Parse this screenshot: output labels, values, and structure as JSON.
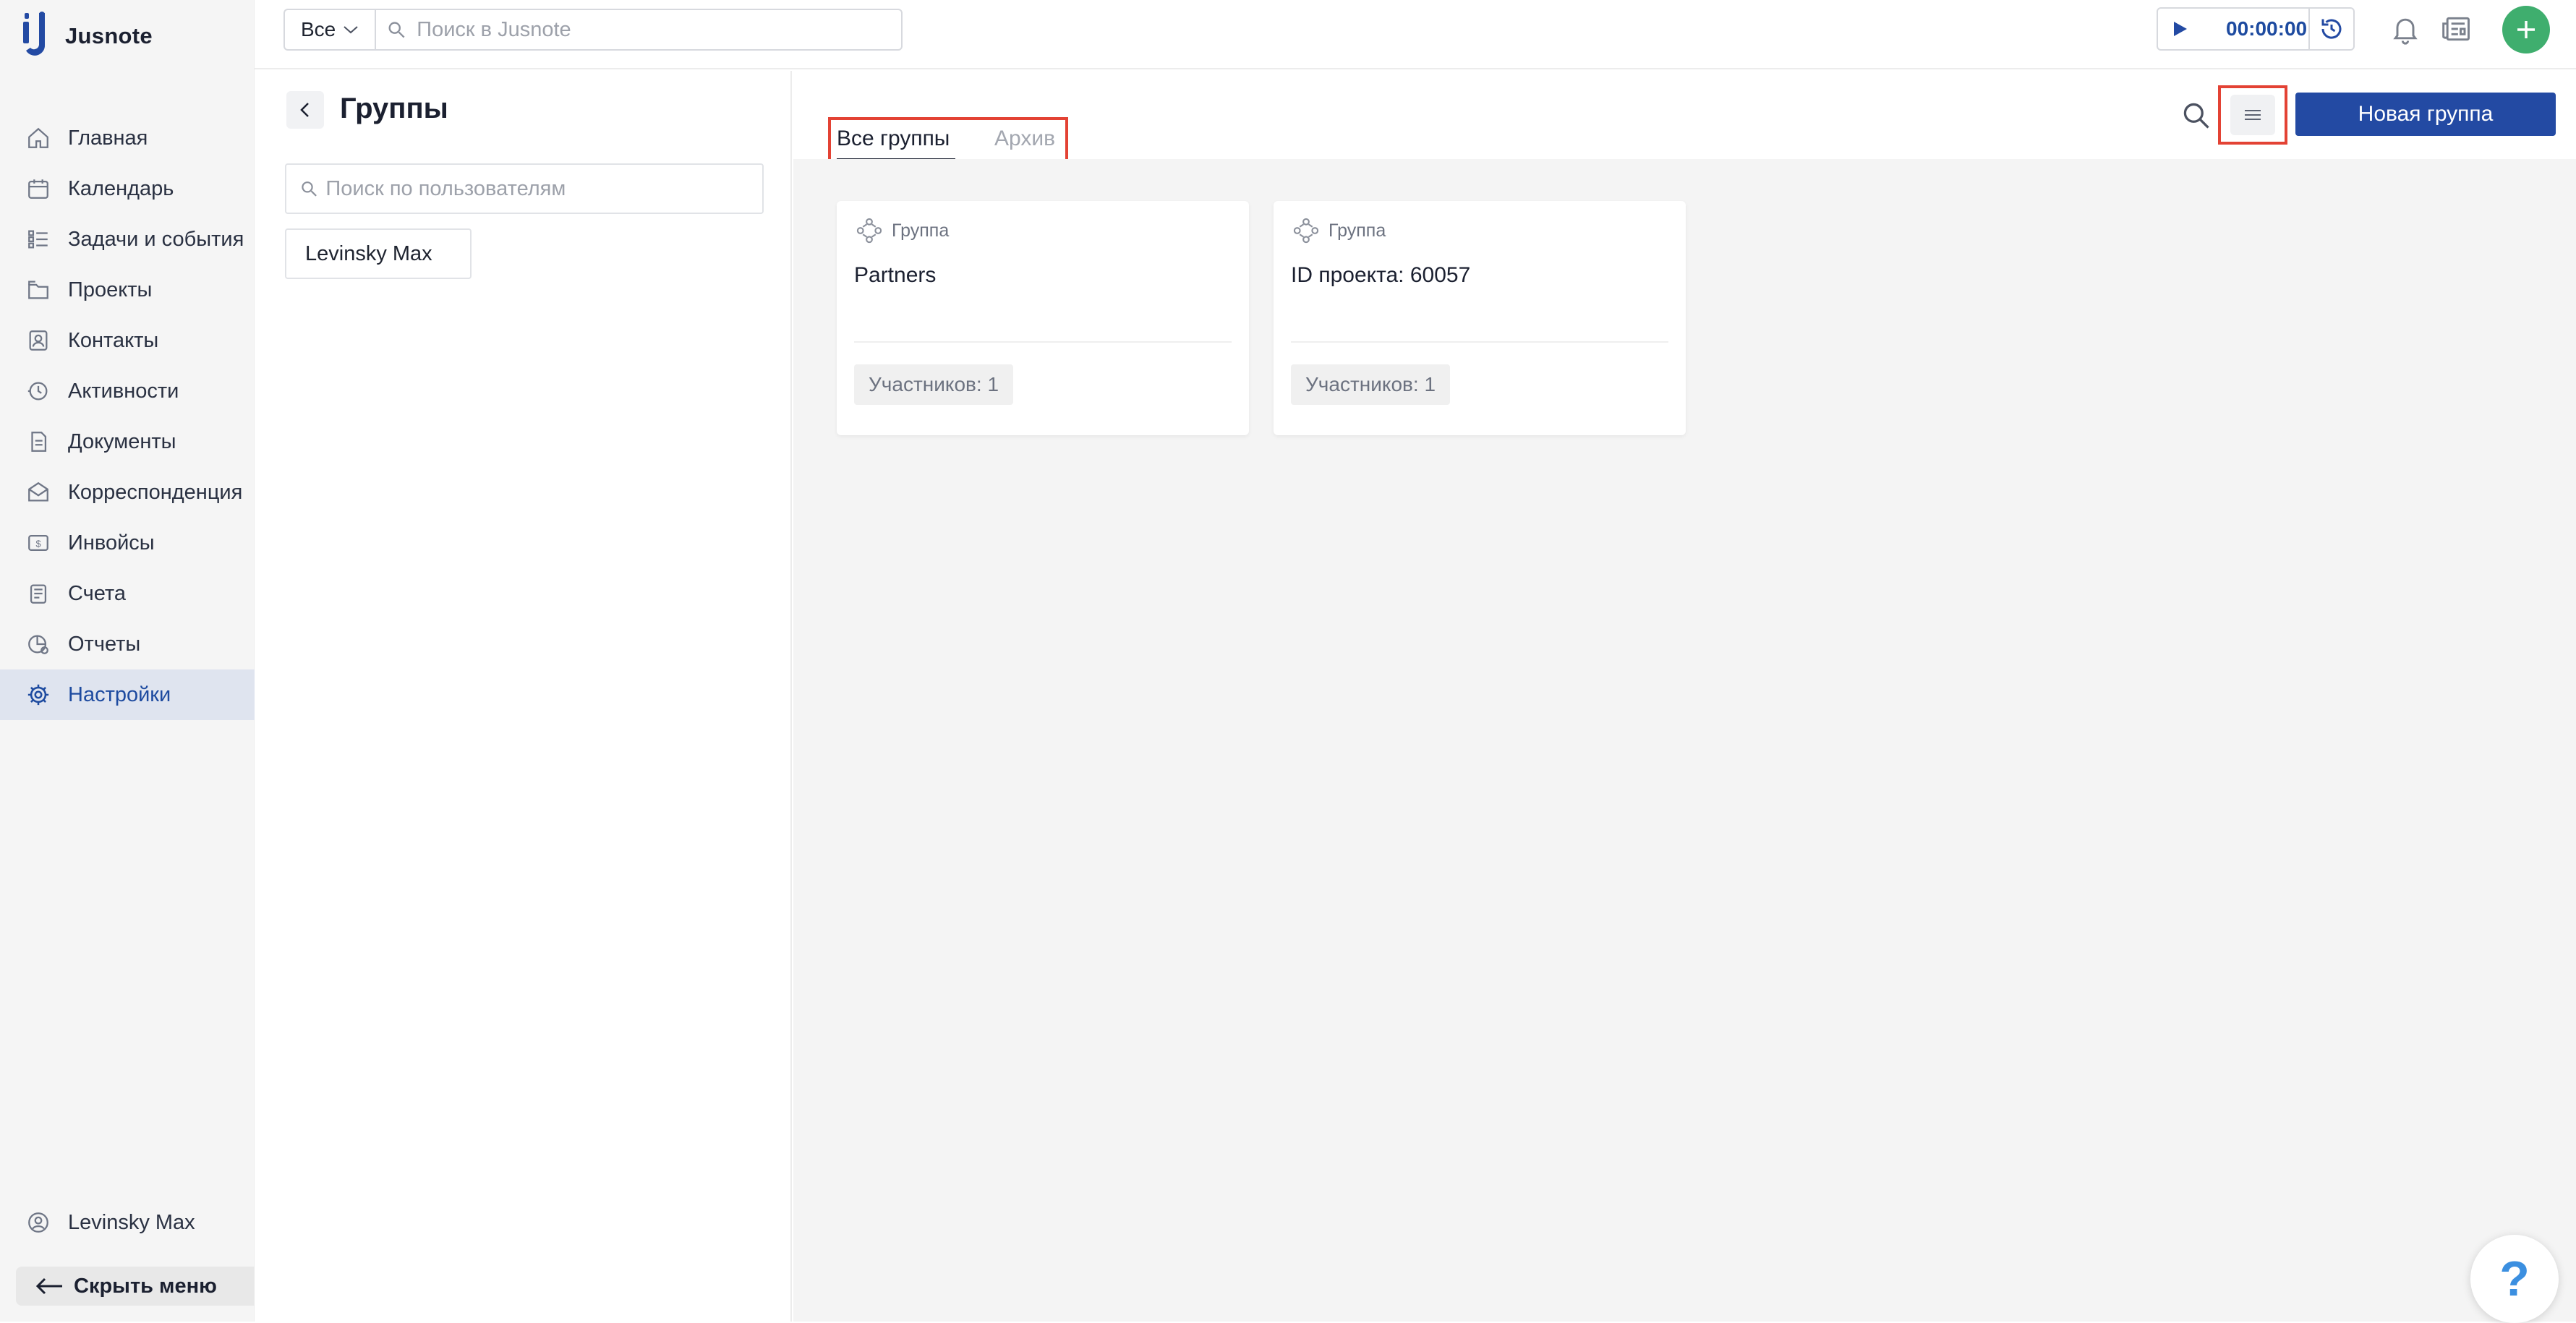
{
  "app": {
    "name": "Jusnote"
  },
  "colors": {
    "accent": "#234aa3",
    "active_nav_bg": "#dfe4ef",
    "highlight": "#e34234",
    "plus": "#3fae6e",
    "help": "#3b8fe0"
  },
  "sidebar": {
    "items": [
      {
        "label": "Главная",
        "icon": "home-icon"
      },
      {
        "label": "Календарь",
        "icon": "calendar-icon"
      },
      {
        "label": "Задачи и события",
        "icon": "tasks-icon"
      },
      {
        "label": "Проекты",
        "icon": "projects-icon"
      },
      {
        "label": "Контакты",
        "icon": "contacts-icon"
      },
      {
        "label": "Активности",
        "icon": "activity-icon"
      },
      {
        "label": "Документы",
        "icon": "documents-icon"
      },
      {
        "label": "Корреспонденция",
        "icon": "mail-icon"
      },
      {
        "label": "Инвойсы",
        "icon": "invoice-icon"
      },
      {
        "label": "Счета",
        "icon": "accounts-icon"
      },
      {
        "label": "Отчеты",
        "icon": "reports-icon"
      },
      {
        "label": "Настройки",
        "icon": "gear-icon",
        "active": true
      }
    ],
    "user": "Levinsky Max",
    "hide_menu": "Скрыть меню"
  },
  "topbar": {
    "scope": "Все",
    "search_placeholder": "Поиск в Jusnote",
    "timer": "00:00:00"
  },
  "left_panel": {
    "title": "Группы",
    "search_placeholder": "Поиск по пользователям",
    "users": [
      "Levinsky Max"
    ]
  },
  "main": {
    "tabs": [
      {
        "label": "Все группы",
        "active": true
      },
      {
        "label": "Архив",
        "active": false
      }
    ],
    "new_group_label": "Новая группа",
    "cards": [
      {
        "kind": "Группа",
        "title": "Partners",
        "members": "Участников: 1"
      },
      {
        "kind": "Группа",
        "title": "ID проекта: 60057",
        "members": "Участников: 1"
      }
    ]
  },
  "help_label": "?"
}
